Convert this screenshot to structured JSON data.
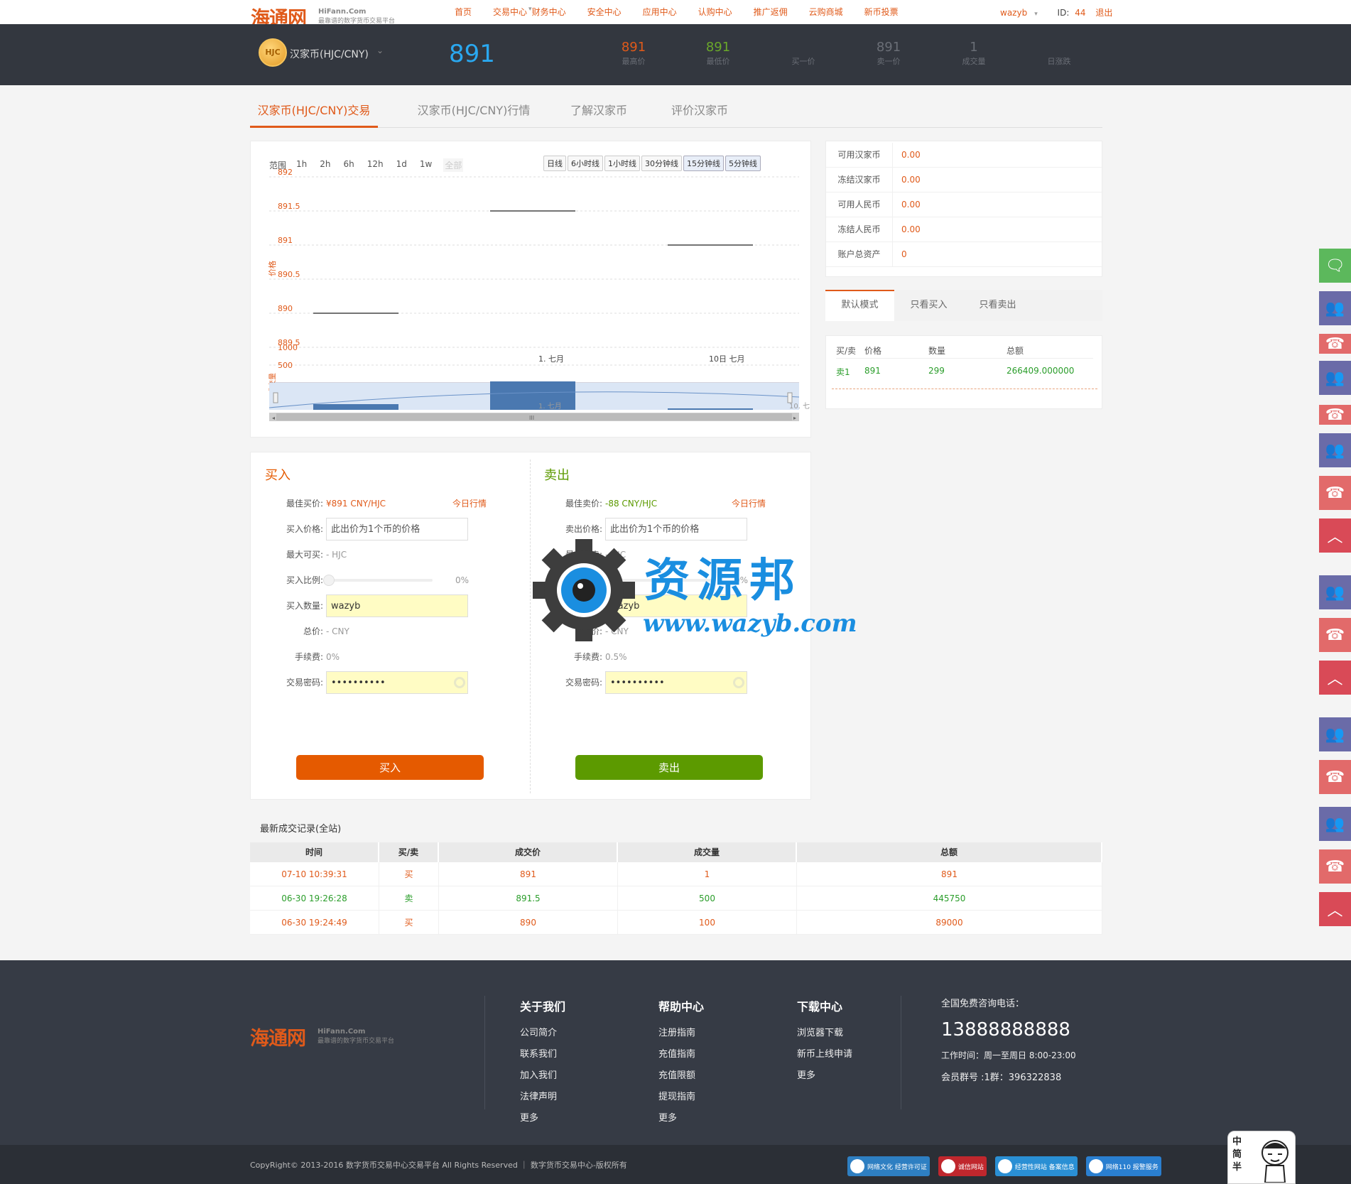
{
  "brand": {
    "name": "海通网",
    "domain": "HiFann.Com",
    "slogan": "最靠谱的数字货币交易平台"
  },
  "nav": [
    "首页",
    "交易中心",
    "财务中心",
    "安全中心",
    "应用中心",
    "认购中心",
    "推广返佣",
    "云购商城",
    "新币投票"
  ],
  "user": {
    "name": "wazyb",
    "id_label": "ID:",
    "id": "44",
    "logout": "退出"
  },
  "ticker": {
    "coin_badge": "HJC",
    "coin_name": "汉家币(HJC/CNY)",
    "price": "891",
    "stats": [
      {
        "value": "891",
        "label": "最高价",
        "color": "#e05a1a"
      },
      {
        "value": "891",
        "label": "最低价",
        "color": "#6aa82a"
      },
      {
        "value": "",
        "label": "买一价",
        "color": "#888"
      },
      {
        "value": "891",
        "label": "卖一价",
        "color": "#6a6e76"
      },
      {
        "value": "1",
        "label": "成交量",
        "color": "#6a6e76"
      },
      {
        "value": "",
        "label": "日涨跌",
        "color": "#888"
      }
    ]
  },
  "tabs": [
    "汉家币(HJC/CNY)交易",
    "汉家币(HJC/CNY)行情",
    "了解汉家币",
    "评价汉家币"
  ],
  "chart": {
    "range_label": "范围",
    "ranges": [
      "1h",
      "2h",
      "6h",
      "12h",
      "1d",
      "1w",
      "全部"
    ],
    "intervals": [
      "日线",
      "6小时线",
      "1小时线",
      "30分钟线",
      "15分钟线",
      "5分钟线"
    ]
  },
  "chart_data": {
    "type": "line",
    "ylabel": "价格",
    "ylabel2": "成交量",
    "y_ticks": [
      "892",
      "891.5",
      "891",
      "890.5",
      "890",
      "889.5"
    ],
    "ylim": [
      889.5,
      892
    ],
    "vol_ticks": [
      "1000",
      "500"
    ],
    "x_ticks": [
      "1. 七月",
      "10日 七月"
    ],
    "nav_ticks": [
      "1. 七月",
      "10. 七"
    ],
    "series": [
      {
        "x": 0,
        "y": 890,
        "volume": 100
      },
      {
        "x": 1,
        "y": 891.5,
        "volume": 500
      },
      {
        "x": 2,
        "y": 891,
        "volume": 1
      }
    ]
  },
  "balances": [
    {
      "label": "可用汉家币",
      "value": "0.00"
    },
    {
      "label": "冻结汉家币",
      "value": "0.00"
    },
    {
      "label": "可用人民币",
      "value": "0.00"
    },
    {
      "label": "冻结人民币",
      "value": "0.00"
    },
    {
      "label": "账户总资产",
      "value": "0"
    }
  ],
  "modes": [
    "默认模式",
    "只看买入",
    "只看卖出"
  ],
  "orderbook": {
    "headers": [
      "买/卖",
      "价格",
      "数量",
      "总额"
    ],
    "rows": [
      {
        "side": "卖1",
        "price": "891",
        "qty": "299",
        "total": "266409.000000"
      }
    ]
  },
  "buy": {
    "title": "买入",
    "best_label": "最佳买价:",
    "best_value": "¥891 CNY/HJC",
    "today": "今日行情",
    "price_label": "买入价格:",
    "price_placeholder": "此出价为1个币的价格",
    "max_label": "最大可买:",
    "max_value": "- HJC",
    "ratio_label": "买入比例:",
    "ratio_value": "0%",
    "qty_label": "买入数量:",
    "qty_value": "wazyb",
    "total_label": "总价:",
    "total_value": "- CNY",
    "fee_label": "手续费:",
    "fee_value": "0%",
    "pwd_label": "交易密码:",
    "pwd_value": "••••••••••",
    "button": "买入",
    "color": "#e55a00"
  },
  "sell": {
    "title": "卖出",
    "best_label": "最佳卖价:",
    "best_value": "-88 CNY/HJC",
    "today": "今日行情",
    "price_label": "卖出价格:",
    "price_placeholder": "此出价为1个币的价格",
    "max_label": "最大可卖:",
    "max_value": "- HJC",
    "ratio_label": "卖出比例:",
    "ratio_value": "0%",
    "qty_label": "卖出数量:",
    "qty_value": "wazyb",
    "total_label": "总价:",
    "total_value": "- CNY",
    "fee_label": "手续费:",
    "fee_value": "0.5%",
    "pwd_label": "交易密码:",
    "pwd_value": "••••••••••",
    "button": "卖出",
    "color": "#5c9a00"
  },
  "history": {
    "title": "最新成交记录(全站)",
    "headers": [
      "时间",
      "买/卖",
      "成交价",
      "成交量",
      "总额"
    ],
    "rows": [
      {
        "time": "07-10 10:39:31",
        "side": "买",
        "price": "891",
        "qty": "1",
        "total": "891",
        "color": "#e05a1a"
      },
      {
        "time": "06-30 19:26:28",
        "side": "卖",
        "price": "891.5",
        "qty": "500",
        "total": "445750",
        "color": "#2a9d2a"
      },
      {
        "time": "06-30 19:24:49",
        "side": "买",
        "price": "890",
        "qty": "100",
        "total": "89000",
        "color": "#e05a1a"
      }
    ]
  },
  "footer": {
    "cols": [
      {
        "title": "关于我们",
        "items": [
          "公司简介",
          "联系我们",
          "加入我们",
          "法律声明",
          "更多"
        ]
      },
      {
        "title": "帮助中心",
        "items": [
          "注册指南",
          "充值指南",
          "充值限额",
          "提现指南",
          "更多"
        ]
      },
      {
        "title": "下载中心",
        "items": [
          "浏览器下载",
          "新币上线申请",
          "更多"
        ]
      }
    ],
    "hotline_label": "全国免费咨询电话：",
    "hotline": "13888888888",
    "hours": "工作时间：周一至周日 8:00-23:00",
    "group": "会员群号 :1群：396322838",
    "copyright": "CopyRight© 2013-2016 数字货币交易中心交易平台 All Rights Reserved ｜ 数字货币交易中心-版权所有",
    "badges": [
      {
        "text": "网络文化 经营许可证",
        "color": "#2e7fc2"
      },
      {
        "text": "诚信网站",
        "color": "#c0272d"
      },
      {
        "text": "经营性网站 备案信息",
        "color": "#2a8fd4"
      },
      {
        "text": "网络110 报警服务",
        "color": "#2a7fd0"
      }
    ]
  },
  "watermark": {
    "cn": "资源邦",
    "url": "www.wazyb.com"
  },
  "mascot": {
    "text": "中简半"
  }
}
